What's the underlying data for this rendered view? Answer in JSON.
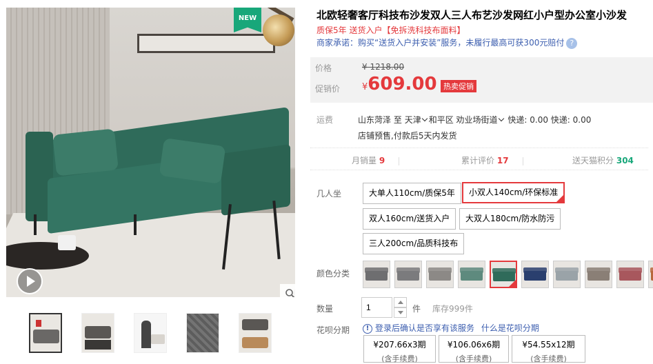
{
  "gallery": {
    "badge": "NEW",
    "thumbnails": [
      "sofa-photo-1",
      "sofa-photo-2",
      "sofa-photo-3",
      "sofa-photo-4",
      "sofa-photo-5"
    ]
  },
  "product": {
    "title": "北欧轻奢客厅科技布沙发双人三人布艺沙发网红小户型办公室小沙发",
    "subtitle": "质保5年 送货入户【免拆洗科技布面料】",
    "promise": "商家承诺：购买“送货入户并安装”服务，未履行最高可获300元赔付"
  },
  "price": {
    "label_original": "价格",
    "original": "¥ 1218.00",
    "label_promo": "促销价",
    "currency": "¥",
    "promo": "609.00",
    "tag": "热卖促销"
  },
  "shipping": {
    "label": "运费",
    "from": "山东菏泽",
    "to_word": "至",
    "city": "天津",
    "district": "和平区",
    "street": "劝业场街道",
    "express": "快递: 0.00 快递: 0.00",
    "note": "店铺预售,付款后5天内发货"
  },
  "stats": [
    {
      "label": "月销量",
      "value": "9"
    },
    {
      "label": "累计评价",
      "value": "17"
    },
    {
      "label": "送天猫积分",
      "value": "304"
    }
  ],
  "options": {
    "size_label": "几人坐",
    "sizes": [
      "大单人110cm/质保5年",
      "小双人140cm/环保标准",
      "双人160cm/送货入户",
      "大双人180cm/防水防污",
      "三人200cm/品质科技布"
    ],
    "selected_size": 1,
    "color_label": "颜色分类",
    "colors": [
      "#6e6e70",
      "#7b7b7d",
      "#8c8986",
      "#5e8a7e",
      "#2f6b5a",
      "#2a3f6e",
      "#9aa3a8",
      "#8a7f76",
      "#a8575d",
      "#b8663b"
    ],
    "selected_color": 4
  },
  "quantity": {
    "label": "数量",
    "value": "1",
    "unit": "件",
    "stock": "库存999件"
  },
  "installment": {
    "label": "花呗分期",
    "notice": "登录后确认是否享有该服务",
    "link": "什么是花呗分期",
    "plans": [
      {
        "price": "¥207.66x3期",
        "sub": "(含手续费)"
      },
      {
        "price": "¥106.06x6期",
        "sub": "(含手续费)"
      },
      {
        "price": "¥54.55x12期",
        "sub": "(含手续费)"
      }
    ]
  },
  "colors": {
    "accent": "#e4393c",
    "link": "#3c5eaf",
    "green": "#18a77a"
  }
}
